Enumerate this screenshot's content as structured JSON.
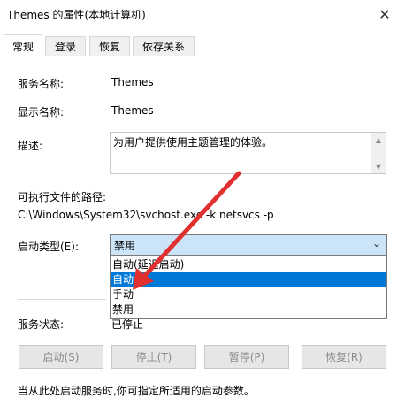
{
  "window": {
    "title": "Themes 的属性(本地计算机)",
    "close": "✕"
  },
  "tabs": [
    {
      "label": "常规"
    },
    {
      "label": "登录"
    },
    {
      "label": "恢复"
    },
    {
      "label": "依存关系"
    }
  ],
  "general": {
    "service_name_label": "服务名称:",
    "service_name_value": "Themes",
    "display_name_label": "显示名称:",
    "display_name_value": "Themes",
    "description_label": "描述:",
    "description_value": "为用户提供使用主题管理的体验。",
    "path_label": "可执行文件的路径:",
    "path_value": "C:\\Windows\\System32\\svchost.exe -k netsvcs -p",
    "startup_label": "启动类型(E):",
    "startup_selected": "禁用",
    "startup_options": [
      "自动(延迟启动)",
      "自动",
      "手动",
      "禁用"
    ],
    "status_label": "服务状态:",
    "status_value": "已停止",
    "buttons": {
      "start": "启动(S)",
      "stop": "停止(T)",
      "pause": "暂停(P)",
      "resume": "恢复(R)"
    },
    "hint": "当从此处启动服务时,你可指定所适用的启动参数。"
  },
  "colors": {
    "highlight": "#0078d7",
    "combo_bg": "#cce4f7",
    "arrow": "#e03030"
  }
}
